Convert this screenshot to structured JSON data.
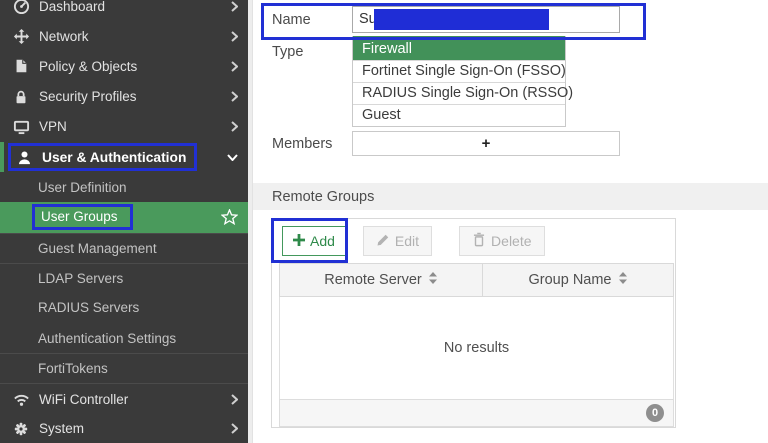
{
  "colors": {
    "sidebar_bg": "#3a3a3a",
    "accent_green": "#4a9a5c",
    "dropdown_selected_green": "#429159",
    "annotation_blue": "#2130d4",
    "redaction_blue": "#1f2dd6",
    "add_button_green": "#2f8a4a"
  },
  "sidebar": {
    "items": [
      {
        "label": "Dashboard",
        "icon": "gauge-icon",
        "chevron": "right"
      },
      {
        "label": "Network",
        "icon": "move-icon",
        "chevron": "right"
      },
      {
        "label": "Policy & Objects",
        "icon": "policy-icon",
        "chevron": "right"
      },
      {
        "label": "Security Profiles",
        "icon": "lock-icon",
        "chevron": "right"
      },
      {
        "label": "VPN",
        "icon": "monitor-icon",
        "chevron": "right"
      },
      {
        "label": "User & Authentication",
        "icon": "user-icon",
        "chevron": "down",
        "state": "expanded, blue-annotated"
      },
      {
        "label": "User Definition",
        "type": "sub-item"
      },
      {
        "label": "User Groups",
        "type": "sub-item",
        "state": "selected green, blue-annotated",
        "icon_right": "star-icon"
      },
      {
        "label": "Guest Management",
        "type": "sub-item"
      },
      {
        "label": "LDAP Servers",
        "type": "sub-item"
      },
      {
        "label": "RADIUS Servers",
        "type": "sub-item"
      },
      {
        "label": "Authentication Settings",
        "type": "sub-item"
      },
      {
        "label": "FortiTokens",
        "type": "sub-item"
      },
      {
        "label": "WiFi Controller",
        "icon": "wifi-icon",
        "chevron": "right"
      },
      {
        "label": "System",
        "icon": "gear-icon",
        "chevron": "right"
      }
    ]
  },
  "form": {
    "name_label": "Name",
    "name_value": "Su",
    "name_redacted": true,
    "type_label": "Type",
    "type_selected": "Firewall",
    "type_options": [
      "Firewall",
      "Fortinet Single Sign-On (FSSO)",
      "RADIUS Single Sign-On (RSSO)",
      "Guest"
    ],
    "members_label": "Members",
    "members_add_symbol": "+"
  },
  "remote_groups": {
    "title": "Remote Groups",
    "toolbar": {
      "add_label": "Add",
      "edit_label": "Edit",
      "delete_label": "Delete"
    },
    "table": {
      "columns": [
        "Remote Server",
        "Group Name"
      ],
      "empty_text": "No results",
      "row_count": "0"
    }
  }
}
